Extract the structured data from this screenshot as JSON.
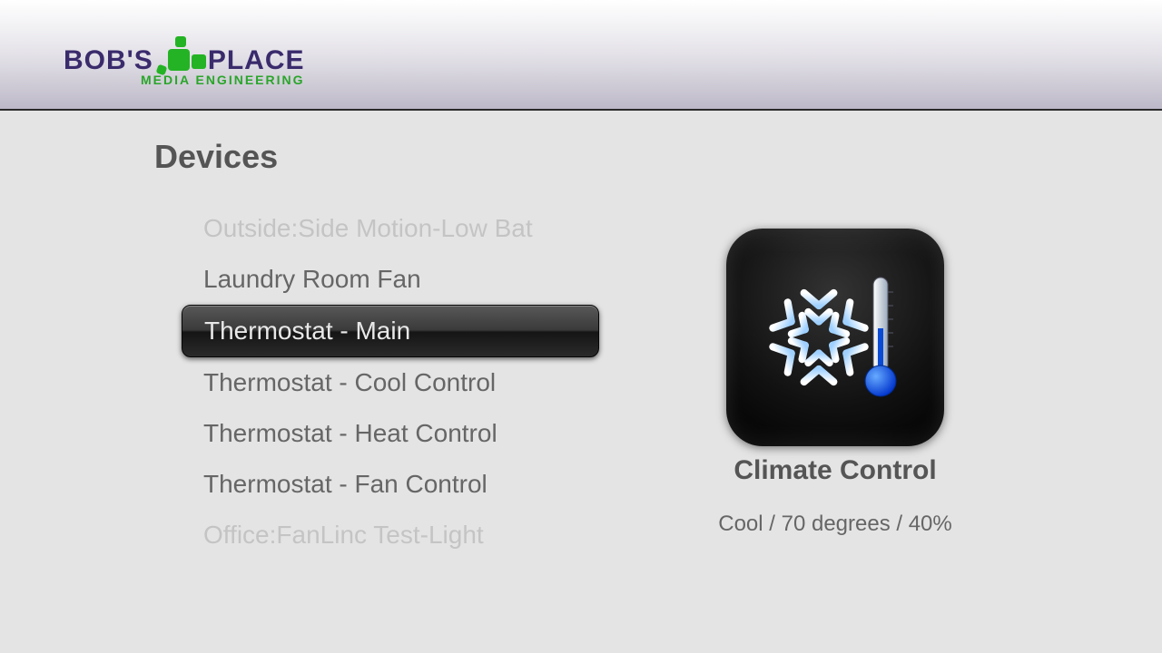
{
  "brand": {
    "line1_a": "BOB'S",
    "line1_b": "PLACE",
    "line2": "MEDIA ENGINEERING"
  },
  "page": {
    "title": "Devices"
  },
  "devices": [
    {
      "label": "Outside:Side Motion-Low Bat",
      "faded": true,
      "selected": false
    },
    {
      "label": "Laundry Room Fan",
      "faded": false,
      "selected": false
    },
    {
      "label": "Thermostat - Main",
      "faded": false,
      "selected": true
    },
    {
      "label": "Thermostat - Cool Control",
      "faded": false,
      "selected": false
    },
    {
      "label": "Thermostat - Heat Control",
      "faded": false,
      "selected": false
    },
    {
      "label": "Thermostat - Fan Control",
      "faded": false,
      "selected": false
    },
    {
      "label": "Office:FanLinc Test-Light",
      "faded": true,
      "selected": false
    }
  ],
  "detail": {
    "icon": "climate-control-icon",
    "title": "Climate Control",
    "status": "Cool /  70 degrees / 40%"
  }
}
